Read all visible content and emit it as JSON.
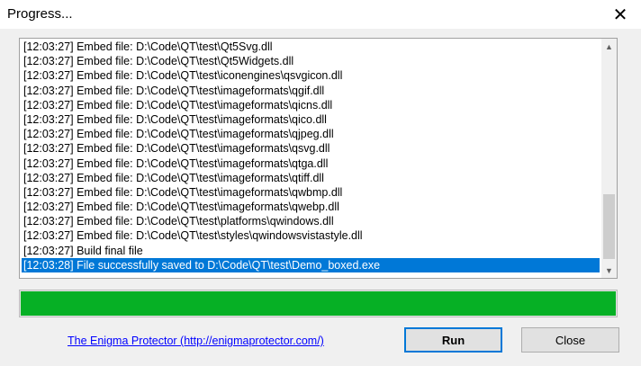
{
  "window": {
    "title": "Progress...",
    "close_glyph": "✕"
  },
  "log": {
    "lines": [
      "[12:03:27] Embed file: D:\\Code\\QT\\test\\Qt5Svg.dll",
      "[12:03:27] Embed file: D:\\Code\\QT\\test\\Qt5Widgets.dll",
      "[12:03:27] Embed file: D:\\Code\\QT\\test\\iconengines\\qsvgicon.dll",
      "[12:03:27] Embed file: D:\\Code\\QT\\test\\imageformats\\qgif.dll",
      "[12:03:27] Embed file: D:\\Code\\QT\\test\\imageformats\\qicns.dll",
      "[12:03:27] Embed file: D:\\Code\\QT\\test\\imageformats\\qico.dll",
      "[12:03:27] Embed file: D:\\Code\\QT\\test\\imageformats\\qjpeg.dll",
      "[12:03:27] Embed file: D:\\Code\\QT\\test\\imageformats\\qsvg.dll",
      "[12:03:27] Embed file: D:\\Code\\QT\\test\\imageformats\\qtga.dll",
      "[12:03:27] Embed file: D:\\Code\\QT\\test\\imageformats\\qtiff.dll",
      "[12:03:27] Embed file: D:\\Code\\QT\\test\\imageformats\\qwbmp.dll",
      "[12:03:27] Embed file: D:\\Code\\QT\\test\\imageformats\\qwebp.dll",
      "[12:03:27] Embed file: D:\\Code\\QT\\test\\platforms\\qwindows.dll",
      "[12:03:27] Embed file: D:\\Code\\QT\\test\\styles\\qwindowsvistastyle.dll",
      "[12:03:27] Build final file",
      "[12:03:28] File successfully saved to D:\\Code\\QT\\test\\Demo_boxed.exe"
    ],
    "selected_index": 15,
    "scroll_up_glyph": "▲",
    "scroll_down_glyph": "▼"
  },
  "progress": {
    "value_percent": 100,
    "color": "#06b025"
  },
  "footer": {
    "link_text": "The Enigma Protector (http://enigmaprotector.com/)",
    "run_label": "Run",
    "close_label": "Close"
  },
  "colors": {
    "selection": "#0078d7",
    "link": "#0000ff"
  }
}
